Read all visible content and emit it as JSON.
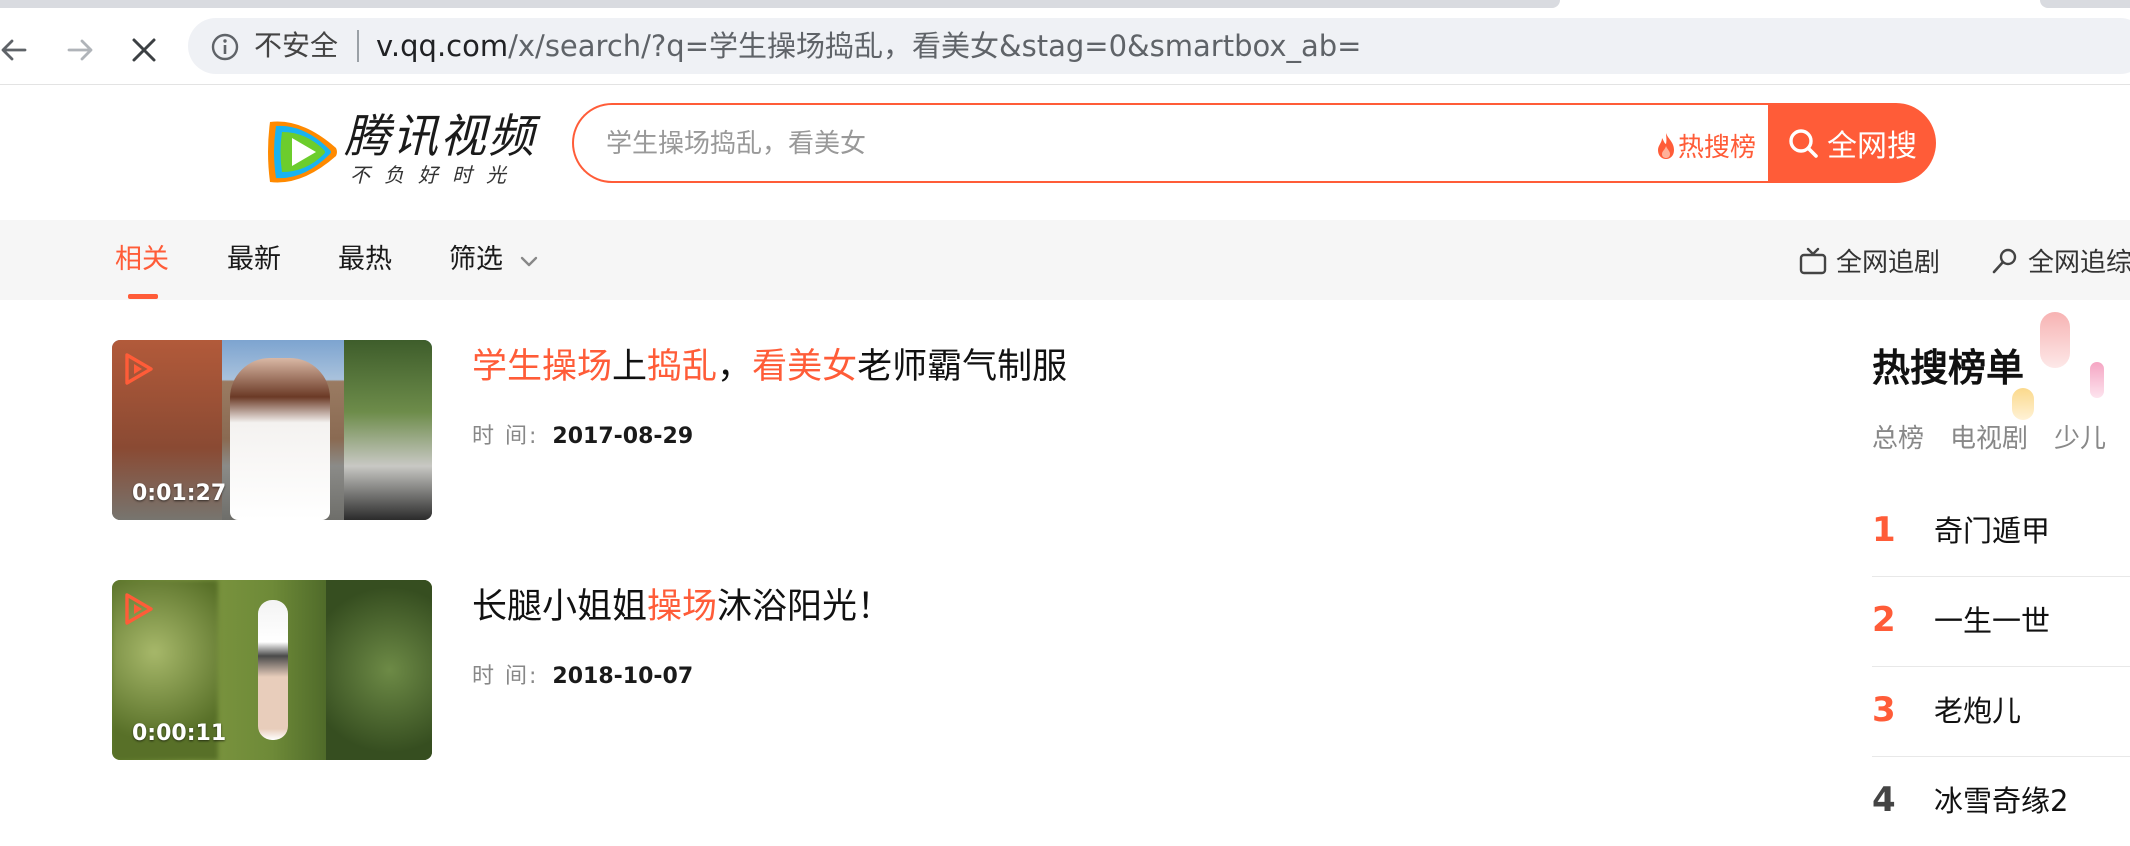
{
  "browser": {
    "back_icon": "arrow-left-icon",
    "forward_icon": "arrow-right-icon",
    "stop_icon": "close-icon",
    "security_label": "不安全",
    "url_host": "v.qq.com",
    "url_path": "/x/search/?q=学生操场捣乱，看美女&stag=0&smartbox_ab="
  },
  "header": {
    "logo_text": "腾讯视频",
    "logo_slogan": "不负好时光",
    "search_placeholder": "学生操场捣乱，看美女",
    "hot_search_label": "热搜榜",
    "search_button_label": "全网搜",
    "brand_color": "#ff5c38"
  },
  "filters": {
    "tabs": [
      {
        "label": "相关",
        "active": true
      },
      {
        "label": "最新",
        "active": false
      },
      {
        "label": "最热",
        "active": false
      },
      {
        "label": "筛选",
        "active": false
      }
    ],
    "right_links": [
      "全网追剧",
      "全网追综"
    ]
  },
  "results": [
    {
      "title_parts": [
        {
          "text": "学生操场",
          "highlight": true
        },
        {
          "text": "上",
          "highlight": false
        },
        {
          "text": "捣乱",
          "highlight": true
        },
        {
          "text": "，",
          "highlight": false
        },
        {
          "text": "看美女",
          "highlight": true
        },
        {
          "text": "老师霸气制服",
          "highlight": false
        }
      ],
      "time_label": "时  间:",
      "date": "2017-08-29",
      "duration": "0:01:27"
    },
    {
      "title_parts": [
        {
          "text": "长腿小姐姐",
          "highlight": false
        },
        {
          "text": "操场",
          "highlight": true
        },
        {
          "text": "沐浴阳光！",
          "highlight": false
        }
      ],
      "time_label": "时  间:",
      "date": "2018-10-07",
      "duration": "0:00:11"
    }
  ],
  "hotlist": {
    "title": "热搜榜单",
    "tabs": [
      "总榜",
      "电视剧",
      "少儿"
    ],
    "items": [
      {
        "rank": "1",
        "name": "奇门遁甲"
      },
      {
        "rank": "2",
        "name": "一生一世"
      },
      {
        "rank": "3",
        "name": "老炮儿"
      },
      {
        "rank": "4",
        "name": "冰雪奇缘2"
      }
    ]
  }
}
